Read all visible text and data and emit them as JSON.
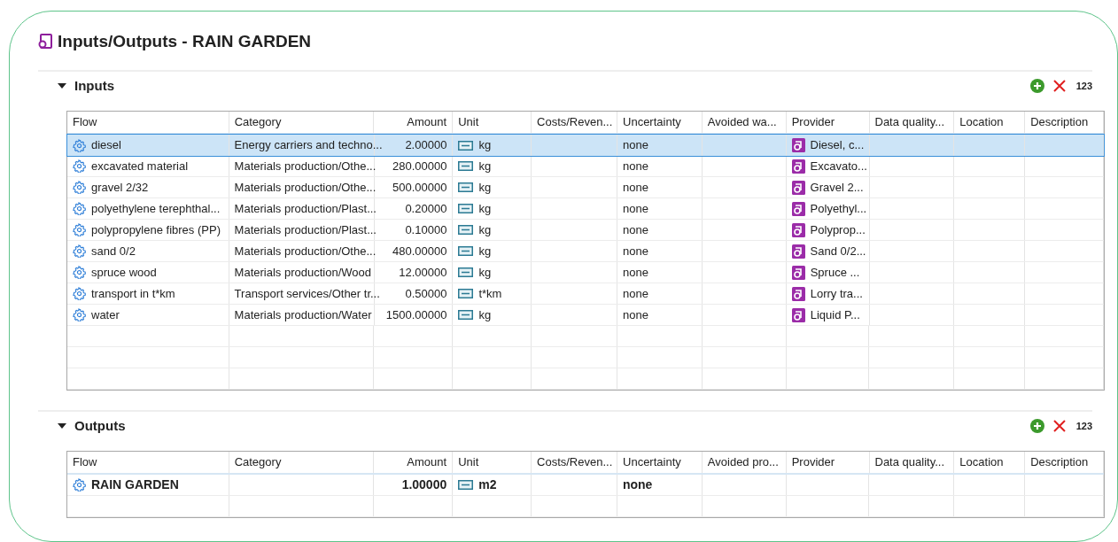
{
  "window": {
    "title": "Inputs/Outputs - RAIN GARDEN"
  },
  "sections": [
    {
      "title": "Inputs",
      "expanded": true,
      "toolbar": {
        "number_format": "123"
      },
      "columns": [
        "Flow",
        "Category",
        "Amount",
        "Unit",
        "Costs/Reven...",
        "Uncertainty",
        "Avoided wa...",
        "Provider",
        "Data quality...",
        "Location",
        "Description"
      ],
      "rows": [
        {
          "selected": true,
          "bold": false,
          "flow": "diesel",
          "category": "Energy carriers and techno...",
          "amount": "2.00000",
          "unit": "kg",
          "uncertainty": "none",
          "provider": "Diesel, c..."
        },
        {
          "selected": false,
          "bold": false,
          "flow": "excavated material",
          "category": "Materials production/Othe...",
          "amount": "280.00000",
          "unit": "kg",
          "uncertainty": "none",
          "provider": "Excavato..."
        },
        {
          "selected": false,
          "bold": false,
          "flow": "gravel 2/32",
          "category": "Materials production/Othe...",
          "amount": "500.00000",
          "unit": "kg",
          "uncertainty": "none",
          "provider": "Gravel 2..."
        },
        {
          "selected": false,
          "bold": false,
          "flow": "polyethylene terephthal...",
          "category": "Materials production/Plast...",
          "amount": "0.20000",
          "unit": "kg",
          "uncertainty": "none",
          "provider": "Polyethyl..."
        },
        {
          "selected": false,
          "bold": false,
          "flow": "polypropylene fibres (PP)",
          "category": "Materials production/Plast...",
          "amount": "0.10000",
          "unit": "kg",
          "uncertainty": "none",
          "provider": "Polyprop..."
        },
        {
          "selected": false,
          "bold": false,
          "flow": "sand 0/2",
          "category": "Materials production/Othe...",
          "amount": "480.00000",
          "unit": "kg",
          "uncertainty": "none",
          "provider": "Sand 0/2..."
        },
        {
          "selected": false,
          "bold": false,
          "flow": "spruce wood",
          "category": "Materials production/Wood",
          "amount": "12.00000",
          "unit": "kg",
          "uncertainty": "none",
          "provider": "Spruce ..."
        },
        {
          "selected": false,
          "bold": false,
          "flow": "transport in t*km",
          "category": "Transport services/Other tr...",
          "amount": "0.50000",
          "unit": "t*km",
          "uncertainty": "none",
          "provider": "Lorry tra..."
        },
        {
          "selected": false,
          "bold": false,
          "flow": "water",
          "category": "Materials production/Water",
          "amount": "1500.00000",
          "unit": "kg",
          "uncertainty": "none",
          "provider": "Liquid P..."
        }
      ]
    },
    {
      "title": "Outputs",
      "expanded": true,
      "toolbar": {
        "number_format": "123"
      },
      "columns": [
        "Flow",
        "Category",
        "Amount",
        "Unit",
        "Costs/Reven...",
        "Uncertainty",
        "Avoided pro...",
        "Provider",
        "Data quality...",
        "Location",
        "Description"
      ],
      "rows": [
        {
          "selected": false,
          "bold": true,
          "flow": "RAIN GARDEN",
          "amount": "1.00000",
          "unit": "m2",
          "uncertainty": "none"
        }
      ]
    }
  ]
}
